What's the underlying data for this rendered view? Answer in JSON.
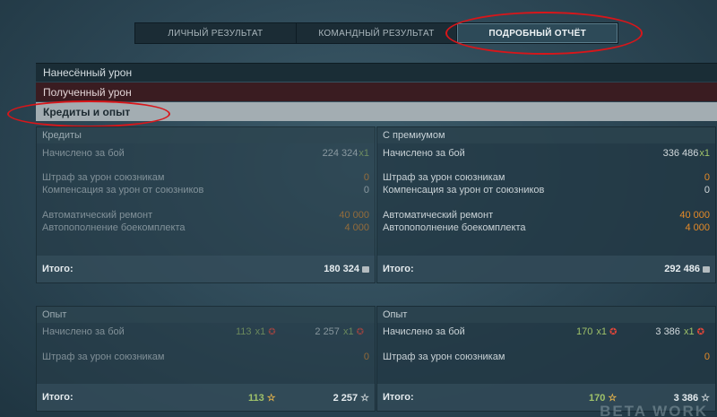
{
  "tabs": [
    {
      "label": "ЛИЧНЫЙ РЕЗУЛЬТАТ"
    },
    {
      "label": "КОМАНДНЫЙ РЕЗУЛЬТАТ"
    },
    {
      "label": "ПОДРОБНЫЙ ОТЧЁТ"
    }
  ],
  "sections": {
    "dealt": "Нанесённый урон",
    "received": "Полученный урон",
    "credits_xp": "Кредиты и опыт"
  },
  "credits": {
    "title": "Кредиты",
    "earned_label": "Начислено за бой",
    "earned": "224 324",
    "earned_mult": "x1",
    "penalty_label": "Штраф за урон союзникам",
    "penalty": "0",
    "comp_label": "Компенсация за урон от союзников",
    "comp": "0",
    "repair_label": "Автоматический ремонт",
    "repair": "40 000",
    "ammo_label": "Автопополнение боекомплекта",
    "ammo": "4 000",
    "total_label": "Итого:",
    "total": "180 324"
  },
  "premium": {
    "title": "С премиумом",
    "earned_label": "Начислено за бой",
    "earned": "336 486",
    "earned_mult": "x1",
    "penalty_label": "Штраф за урон союзникам",
    "penalty": "0",
    "comp_label": "Компенсация за урон от союзников",
    "comp": "0",
    "repair_label": "Автоматический ремонт",
    "repair": "40 000",
    "ammo_label": "Автопополнение боекомплекта",
    "ammo": "4 000",
    "total_label": "Итого:",
    "total": "292 486"
  },
  "xp": {
    "title": "Опыт",
    "earned_label": "Начислено за бой",
    "earned_a": "113",
    "earned_a_mult": "x1",
    "earned_b": "2 257",
    "earned_b_mult": "x1",
    "penalty_label": "Штраф за урон союзникам",
    "penalty": "0",
    "total_label": "Итого:",
    "total_a": "113",
    "total_b": "2 257"
  },
  "xp_premium": {
    "title": "Опыт",
    "earned_label": "Начислено за бой",
    "earned_a": "170",
    "earned_a_mult": "x1",
    "earned_b": "3 386",
    "earned_b_mult": "x1",
    "penalty_label": "Штраф за урон союзникам",
    "penalty": "0",
    "total_label": "Итого:",
    "total_a": "170",
    "total_b": "3 386"
  },
  "watermark": "BETA  WORK",
  "colors": {
    "highlight_ring": "#d8161a",
    "accent_orange": "#e58a27",
    "accent_green": "#9fc26a",
    "premium_gold": "#f0a93a"
  }
}
